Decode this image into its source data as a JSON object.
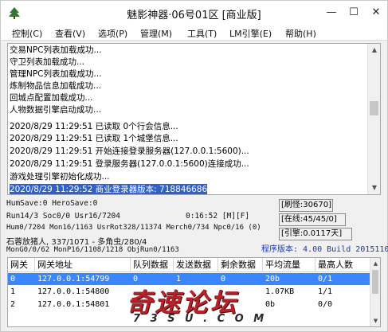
{
  "window": {
    "title": "魅影神器·06号01区 [商业版]",
    "min_glyph": "—",
    "max_glyph": "☐",
    "close_glyph": "✕",
    "icon": "app-tree-icon"
  },
  "menu": [
    {
      "label": "控制(C)"
    },
    {
      "label": "查看(V)"
    },
    {
      "label": "选项(P)"
    },
    {
      "label": "管理(M)"
    },
    {
      "label": "工具(T)"
    },
    {
      "label": "LM引擎(E)"
    },
    {
      "label": "帮助(H)"
    }
  ],
  "log": {
    "lines": [
      "交易NPC列表加载成功...",
      "守卫列表加载成功...",
      "管理NPC列表加载成功...",
      "炼制物品信息加载成功...",
      "回城点配置加载成功...",
      "人物数据引擎启动成功...",
      "2020/8/29 11:29:51 已读取 0个行会信息...",
      "2020/8/29 11:29:51 已读取 1个城堡信息...",
      "2020/8/29 11:29:51 开始连接登录服务器(127.0.0.1:5600)...",
      "2020/8/29 11:29:51 登录服务器(127.0.0.1:5600)连接成功...",
      "游戏处理引擎初始化成功...",
      "2020/8/29 11:29:52 商业登录器版本: 718846686"
    ],
    "selected_index": 11
  },
  "status": {
    "line1": "HumSave:0 HeroSave:0",
    "line2a": "Run14/3 Soc0/0 Usr16/7204",
    "line2b": "0:16:52 [M][F]",
    "line3": "Hum0/7204 Mon16/1163 UsrRot328/11374 Merch0/734 Npc0/16 (0)",
    "line4": "石蓉放猪人, 337/1071 - 多角虫/280/4",
    "line5": "MonG0/0/62 MonP16/1108/1218 ObjRun0/1163",
    "refresh": "[刷怪:30670]",
    "online": "[在线:45/45/0]",
    "engine": "[引擎:0.0117天]",
    "version": "程序版本: 4.00 Build 20151104"
  },
  "table": {
    "headers": [
      "网关",
      "网关地址",
      "队列数据",
      "发送数据",
      "剩余数据",
      "平均流量",
      "最高人数"
    ],
    "rows": [
      [
        "0",
        "127.0.0.1:54799",
        "0",
        "1",
        "0",
        "20b",
        "0/1"
      ],
      [
        "1",
        "127.0.0.1:54800",
        "",
        "",
        "",
        "1.07KB",
        "1/1"
      ],
      [
        "2",
        "127.0.0.1:54801",
        "",
        "",
        "",
        "0b",
        "0/0"
      ]
    ],
    "selected_index": 0
  },
  "watermark": {
    "main": "奇速论坛",
    "sub": "7 3 S U . C O M"
  },
  "colors": {
    "log_selection": "#3060c8",
    "table_selection": "#3a86ff",
    "version_text": "#1a3ca8",
    "watermark": "#b8202a"
  }
}
